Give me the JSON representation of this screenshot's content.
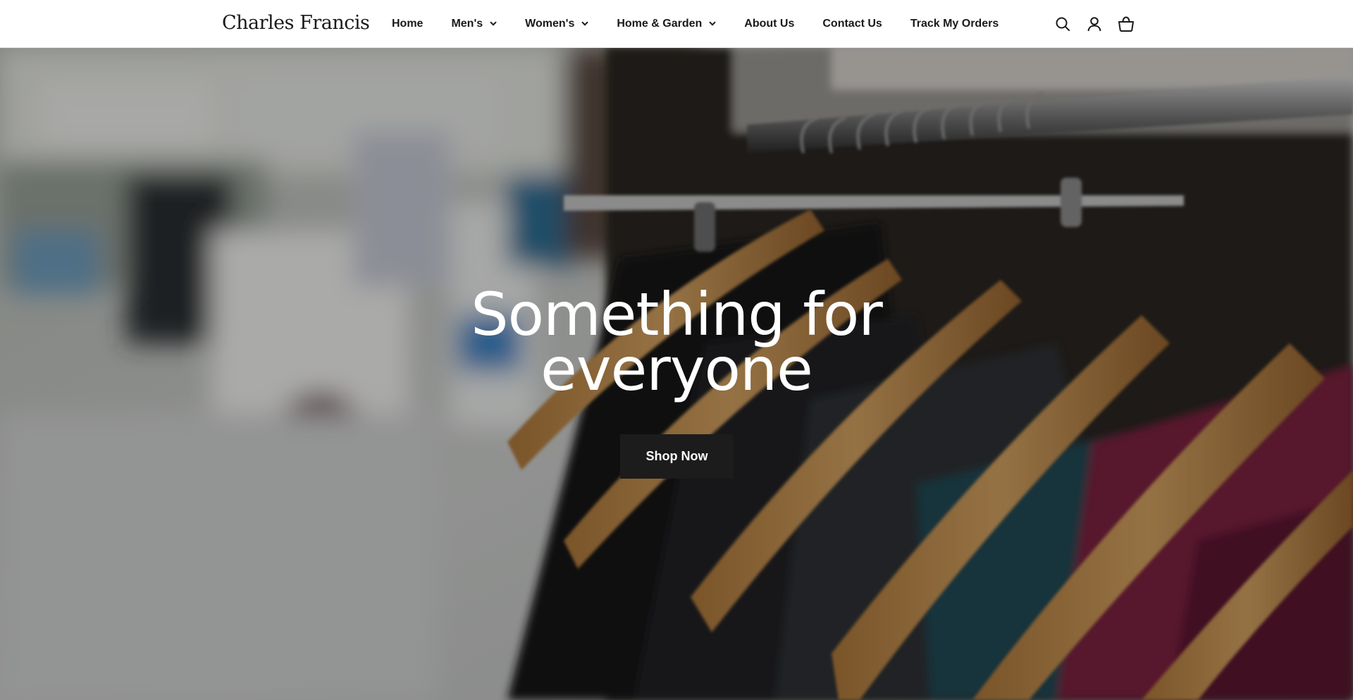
{
  "header": {
    "logo_text": "Charles Francis",
    "nav": [
      {
        "label": "Home",
        "has_dropdown": false
      },
      {
        "label": "Men's",
        "has_dropdown": true
      },
      {
        "label": "Women's",
        "has_dropdown": true
      },
      {
        "label": "Home & Garden",
        "has_dropdown": true
      },
      {
        "label": "About Us",
        "has_dropdown": false
      },
      {
        "label": "Contact Us",
        "has_dropdown": false
      },
      {
        "label": "Track My Orders",
        "has_dropdown": false
      }
    ],
    "icons": [
      "search-icon",
      "account-icon",
      "cart-icon"
    ]
  },
  "hero": {
    "title_line1": "Something for",
    "title_line2": "everyone",
    "button_label": "Shop Now"
  },
  "colors": {
    "header_bg": "#ffffff",
    "text_dark": "#1a1a1a",
    "button_bg": "#1c1c1c",
    "button_text": "#ffffff",
    "hero_text": "#ffffff"
  }
}
